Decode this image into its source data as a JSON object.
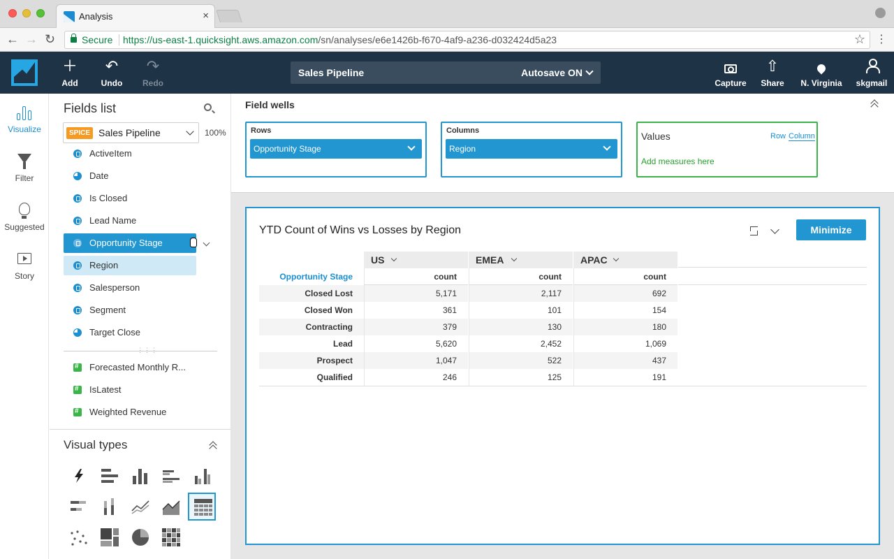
{
  "browser": {
    "tab_title": "Analysis",
    "tab_close": "×",
    "secure_label": "Secure",
    "url_scheme": "https://",
    "url_host": "us-east-1.quicksight.aws.amazon.com",
    "url_path": "/sn/analyses/e6e1426b-f670-4af9-a236-d032424d5a23",
    "icons": [
      "back-arrow-icon",
      "forward-arrow-icon",
      "reload-icon",
      "lock-icon",
      "star-icon",
      "menu-icon"
    ]
  },
  "header": {
    "add_label": "Add",
    "undo_label": "Undo",
    "redo_label": "Redo",
    "analysis_title": "Sales Pipeline",
    "autosave_label": "Autosave ON",
    "capture_label": "Capture",
    "share_label": "Share",
    "region_label": "N. Virginia",
    "user_label": "skgmail",
    "brand_color": "#1f3347",
    "accent_color": "#26a6e2"
  },
  "rail": {
    "visualize": "Visualize",
    "filter": "Filter",
    "suggested": "Suggested",
    "story": "Story"
  },
  "fields": {
    "title": "Fields list",
    "dataset_badge": "SPICE",
    "dataset_name": "Sales Pipeline",
    "spice_percent": "100%",
    "dimensions": [
      {
        "label": "ActiveItem",
        "kind": "dimension"
      },
      {
        "label": "Date",
        "kind": "date"
      },
      {
        "label": "Is Closed",
        "kind": "dimension"
      },
      {
        "label": "Lead Name",
        "kind": "dimension"
      },
      {
        "label": "Opportunity Stage",
        "kind": "dimension",
        "state": "selected"
      },
      {
        "label": "Region",
        "kind": "dimension",
        "state": "hover"
      },
      {
        "label": "Salesperson",
        "kind": "dimension"
      },
      {
        "label": "Segment",
        "kind": "dimension"
      },
      {
        "label": "Target Close",
        "kind": "date"
      }
    ],
    "measures": [
      {
        "label": "Forecasted Monthly R...",
        "kind": "measure"
      },
      {
        "label": "IsLatest",
        "kind": "measure"
      },
      {
        "label": "Weighted Revenue",
        "kind": "measure"
      }
    ]
  },
  "visual_types": {
    "title": "Visual types",
    "items": [
      "autograph",
      "horizontal-bar",
      "vertical-bar",
      "clustered-horizontal-bar",
      "clustered-vertical-bar",
      "stacked-horizontal-bar",
      "stacked-vertical-bar",
      "line",
      "area-line",
      "pivot-table",
      "scatter",
      "tree-map",
      "pie",
      "heat-map"
    ],
    "selected": "pivot-table"
  },
  "field_wells": {
    "title": "Field wells",
    "rows_label": "Rows",
    "rows_value": "Opportunity Stage",
    "columns_label": "Columns",
    "columns_value": "Region",
    "values_label": "Values",
    "values_row_toggle": "Row",
    "values_col_toggle": "Column",
    "values_placeholder": "Add measures here"
  },
  "visual": {
    "title": "YTD Count of Wins vs Losses by Region",
    "minimize_label": "Minimize",
    "row_header_title": "Opportunity Stage",
    "columns": [
      "US",
      "EMEA",
      "APAC"
    ],
    "measure_label": "count",
    "rows": [
      {
        "stage": "Closed Lost",
        "values": [
          "5,171",
          "2,117",
          "692"
        ]
      },
      {
        "stage": "Closed Won",
        "values": [
          "361",
          "101",
          "154"
        ]
      },
      {
        "stage": "Contracting",
        "values": [
          "379",
          "130",
          "180"
        ]
      },
      {
        "stage": "Lead",
        "values": [
          "5,620",
          "2,452",
          "1,069"
        ]
      },
      {
        "stage": "Prospect",
        "values": [
          "1,047",
          "522",
          "437"
        ]
      },
      {
        "stage": "Qualified",
        "values": [
          "246",
          "125",
          "191"
        ]
      }
    ]
  }
}
